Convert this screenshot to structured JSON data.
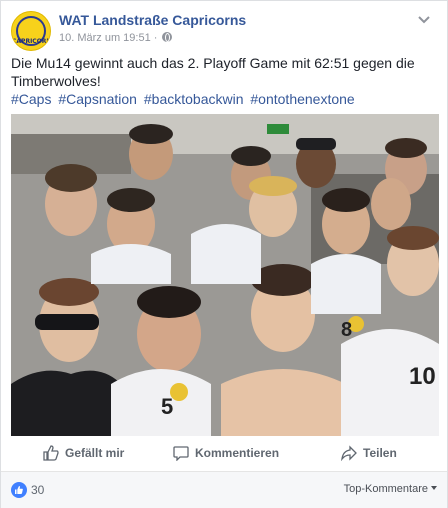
{
  "post": {
    "page_name": "WAT Landstraße Capricorns",
    "timestamp": "10. März um 19:51",
    "separator": "·",
    "avatar_logo_text": "CAPRICORNS",
    "text": "Die Mu14 gewinnt auch das 2. Playoff Game mit 62:51 gegen die Timberwolves!",
    "hashtags": [
      "#Caps",
      "#Capsnation",
      "#backtobackwin",
      "#ontothenextone"
    ]
  },
  "actions": {
    "like_label": "Gefällt mir",
    "comment_label": "Kommentieren",
    "share_label": "Teilen"
  },
  "footer": {
    "like_count": "30",
    "sort_label": "Top-Kommentare"
  },
  "colors": {
    "link": "#365899",
    "meta": "#90949c",
    "like_badge": "#4080ff"
  },
  "icons": {
    "chevron": "chevron-down-icon",
    "globe": "globe-icon",
    "like": "thumbs-up-icon",
    "comment": "comment-icon",
    "share": "share-icon"
  }
}
